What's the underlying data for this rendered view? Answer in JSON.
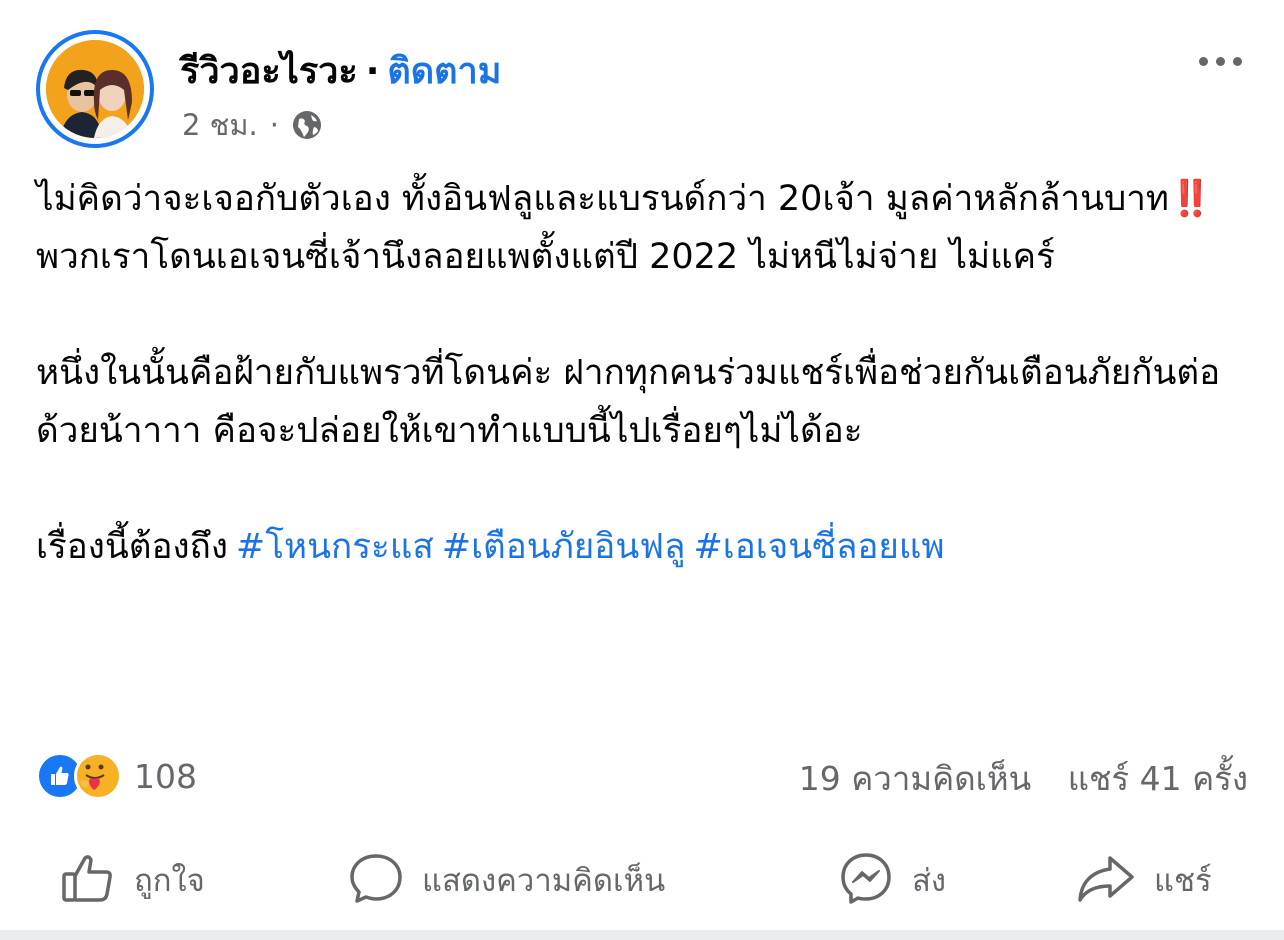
{
  "post": {
    "page_name": "รีวิวอะไรวะ",
    "separator": "·",
    "follow_label": "ติดตาม",
    "time": "2 ชม.",
    "meta_separator": "·",
    "privacy_icon": "globe-icon",
    "more_icon": "more-horizontal-icon",
    "paragraph1_part1": "ไม่คิดว่าจะเจอกับตัวเอง ทั้งอินฟลูและแบรนด์กว่า 20เจ้า มูลค่าหลักล้านบาท",
    "paragraph1_emoji": "‼️",
    "paragraph1_part2": " พวกเราโดนเอเจนซี่เจ้านึงลอยแพตั้งแต่ปี 2022 ไม่หนีไม่จ่าย ไม่แคร์",
    "paragraph2": "หนึ่งในนั้นคือฝ้ายกับแพรวที่โดนค่ะ ฝากทุกคนร่วมแชร์เพื่อช่วยกันเตือนภัยกันต่อด้วยน้าาาา คือจะปล่อยให้เขาทำแบบนี้ไปเรื่อยๆไม่ได้อะ",
    "paragraph3": "เรื่องนี้ต้องถึง",
    "hashtags": [
      "#โหนกระแส",
      "#เตือนภัยอินฟลู",
      "#เอเจนซี่ลอยแพ"
    ]
  },
  "stats": {
    "reaction_icons": [
      "like-reaction-icon",
      "care-reaction-icon"
    ],
    "reaction_count": "108",
    "comments": "19 ความคิดเห็น",
    "shares": "แชร์ 41 ครั้ง"
  },
  "actions": {
    "like": "ถูกใจ",
    "comment": "แสดงความคิดเห็น",
    "send": "ส่ง",
    "share": "แชร์"
  },
  "colors": {
    "accent": "#1b74e4",
    "meta_text": "#65676b",
    "avatar_bg": "#f3a21b",
    "like_blue": "#1877f2",
    "care_yellow": "#f7b125"
  }
}
